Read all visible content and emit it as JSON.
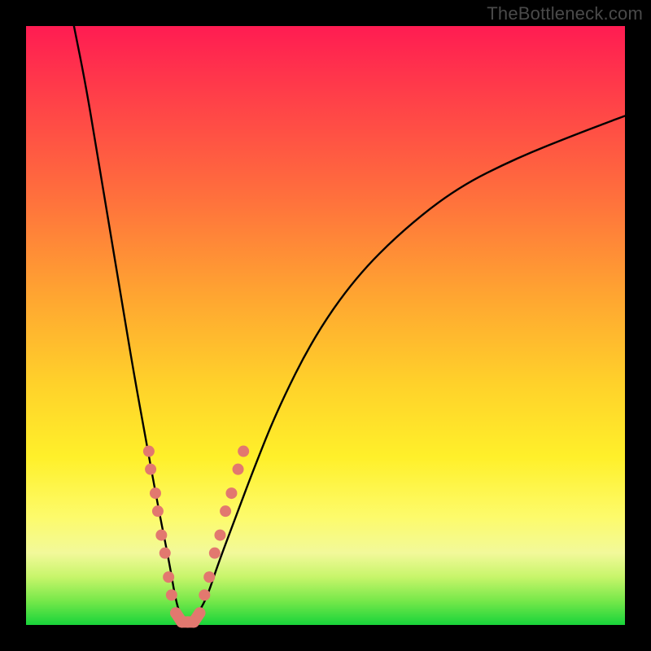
{
  "watermark": "TheBottleneck.com",
  "chart_data": {
    "type": "line",
    "title": "",
    "xlabel": "",
    "ylabel": "",
    "xlim": [
      0,
      100
    ],
    "ylim": [
      0,
      100
    ],
    "grid": false,
    "legend": false,
    "series": [
      {
        "name": "bottleneck-curve",
        "x": [
          8,
          10,
          12,
          14,
          16,
          18,
          20,
          22,
          24,
          25,
          26,
          27,
          28,
          30,
          32,
          35,
          38,
          42,
          48,
          55,
          63,
          72,
          82,
          92,
          100
        ],
        "y": [
          100,
          90,
          78,
          66,
          54,
          42,
          31,
          20,
          10,
          4,
          1,
          0,
          1,
          4,
          10,
          18,
          26,
          36,
          48,
          58,
          66,
          73,
          78,
          82,
          85
        ]
      }
    ],
    "markers": {
      "name": "highlight-dots",
      "color": "#e2786f",
      "points": [
        {
          "x": 20.5,
          "y": 29
        },
        {
          "x": 20.8,
          "y": 26
        },
        {
          "x": 21.6,
          "y": 22
        },
        {
          "x": 22.0,
          "y": 19
        },
        {
          "x": 22.6,
          "y": 15
        },
        {
          "x": 23.2,
          "y": 12
        },
        {
          "x": 23.8,
          "y": 8
        },
        {
          "x": 24.3,
          "y": 5
        },
        {
          "x": 25.0,
          "y": 2
        },
        {
          "x": 26.0,
          "y": 0.5
        },
        {
          "x": 27.0,
          "y": 0.5
        },
        {
          "x": 28.0,
          "y": 0.5
        },
        {
          "x": 29.0,
          "y": 2
        },
        {
          "x": 29.8,
          "y": 5
        },
        {
          "x": 30.6,
          "y": 8
        },
        {
          "x": 31.5,
          "y": 12
        },
        {
          "x": 32.4,
          "y": 15
        },
        {
          "x": 33.3,
          "y": 19
        },
        {
          "x": 34.3,
          "y": 22
        },
        {
          "x": 35.4,
          "y": 26
        },
        {
          "x": 36.3,
          "y": 29
        }
      ]
    }
  }
}
